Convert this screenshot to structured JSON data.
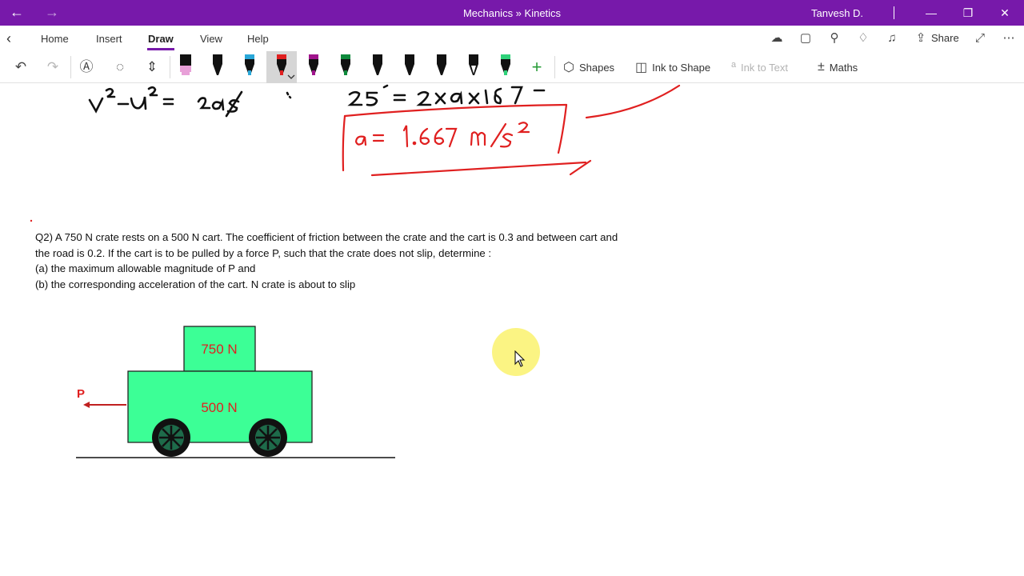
{
  "titlebar": {
    "title": "Mechanics » Kinetics",
    "user": "Tanvesh D.",
    "back_icon": "arrow-left-icon",
    "forward_icon": "arrow-right-icon",
    "color": "#7719aa"
  },
  "menu": {
    "tabs": [
      {
        "label": "Home"
      },
      {
        "label": "Insert"
      },
      {
        "label": "Draw",
        "active": true
      },
      {
        "label": "View"
      },
      {
        "label": "Help"
      }
    ],
    "share_label": "Share"
  },
  "toolbar": {
    "shapes_label": "Shapes",
    "ink_to_shape_label": "Ink to Shape",
    "ink_to_text_label": "Ink to Text",
    "maths_label": "Maths",
    "pens": [
      {
        "name": "highlighter-pink",
        "color": "#e8a0d8"
      },
      {
        "name": "pen-black-1",
        "color": "#111111"
      },
      {
        "name": "pen-cyan",
        "color": "#2aa7d8"
      },
      {
        "name": "pen-red",
        "color": "#e02020",
        "selected": true
      },
      {
        "name": "pen-purple",
        "color": "#a0148c"
      },
      {
        "name": "pen-green",
        "color": "#0e8a3c"
      },
      {
        "name": "pen-black-2",
        "color": "#111111"
      },
      {
        "name": "pen-black-3",
        "color": "#111111"
      },
      {
        "name": "pen-black-4",
        "color": "#111111"
      },
      {
        "name": "pen-black-5",
        "color": "#111111"
      },
      {
        "name": "pen-lightgreen",
        "color": "#2fd27a"
      }
    ]
  },
  "page": {
    "ink_top_left": "v² - u² = 2as",
    "ink_top_mid": "25² = 2 x a x 187.5",
    "ink_answer": "a = 1.667 m/s²",
    "question_lines": [
      "Q2) A 750 N crate rests on a 500 N cart. The coefficient of friction between the crate and the cart is 0.3 and between cart and",
      "the road is 0.2. If the cart is to be pulled by a force P, such that the crate does not slip, determine :",
      "(a)  the maximum allowable magnitude of P and",
      "(b)  the corresponding acceleration of the cart. N crate is about to slip"
    ],
    "figure": {
      "crate_label": "750 N",
      "cart_label": "500 N",
      "force_label": "P",
      "body_color": "#3cff96",
      "label_color": "#e02020"
    }
  }
}
